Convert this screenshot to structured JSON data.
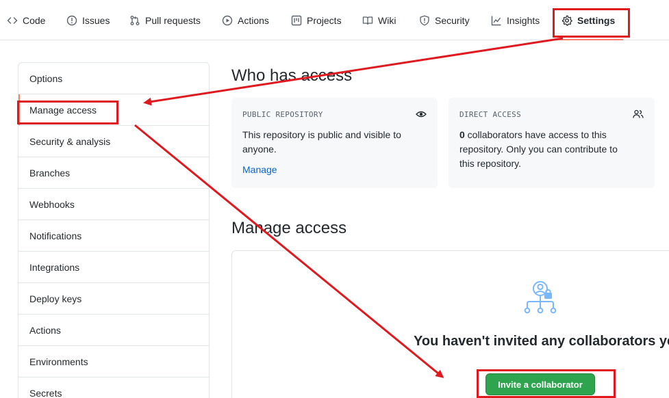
{
  "topnav": {
    "tabs": [
      {
        "label": "Code",
        "icon": "code-icon"
      },
      {
        "label": "Issues",
        "icon": "issue-opened-icon"
      },
      {
        "label": "Pull requests",
        "icon": "git-pull-request-icon"
      },
      {
        "label": "Actions",
        "icon": "play-icon"
      },
      {
        "label": "Projects",
        "icon": "project-icon"
      },
      {
        "label": "Wiki",
        "icon": "book-icon"
      },
      {
        "label": "Security",
        "icon": "shield-icon"
      },
      {
        "label": "Insights",
        "icon": "graph-icon"
      },
      {
        "label": "Settings",
        "icon": "gear-icon",
        "active": true
      }
    ]
  },
  "sidebar": {
    "items": [
      {
        "label": "Options"
      },
      {
        "label": "Manage access",
        "active": true
      },
      {
        "label": "Security & analysis"
      },
      {
        "label": "Branches"
      },
      {
        "label": "Webhooks"
      },
      {
        "label": "Notifications"
      },
      {
        "label": "Integrations"
      },
      {
        "label": "Deploy keys"
      },
      {
        "label": "Actions"
      },
      {
        "label": "Environments"
      },
      {
        "label": "Secrets"
      }
    ]
  },
  "main": {
    "who_has_access_title": "Who has access",
    "public_card": {
      "caption": "PUBLIC REPOSITORY",
      "text": "This repository is public and visible to anyone.",
      "link": "Manage",
      "icon": "eye-icon"
    },
    "direct_card": {
      "caption": "DIRECT ACCESS",
      "count": "0",
      "text": " collaborators have access to this repository. Only you can contribute to this repository.",
      "icon": "people-icon"
    },
    "manage_access_title": "Manage access",
    "empty_state": {
      "icon": "collaborators-lock-icon",
      "title": "You haven't invited any collaborators yet",
      "button": "Invite a collaborator"
    }
  },
  "colors": {
    "annotation_red": "#e0191f",
    "active_underline": "#f9826c",
    "button_green": "#2ea44f",
    "link_blue": "#0366d6",
    "card_bg": "#f6f8fa",
    "illustration_blue": "#79b8ff"
  }
}
